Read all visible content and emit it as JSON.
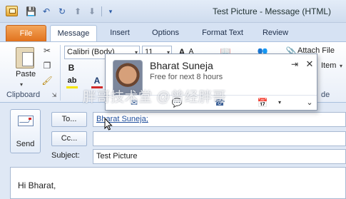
{
  "window": {
    "title": "Test Picture  -  Message (HTML)"
  },
  "quick_access": {
    "icons": [
      "save-icon",
      "undo-icon",
      "redo-icon",
      "up-arrow-icon",
      "down-arrow-icon",
      "customize-icon"
    ]
  },
  "ribbon_tabs": [
    "File",
    "Message",
    "Insert",
    "Options",
    "Format Text",
    "Review"
  ],
  "active_tab": "Message",
  "ribbon": {
    "clipboard": {
      "paste_label": "Paste",
      "group_label": "Clipboard"
    },
    "basic_text": {
      "font_name": "Calibri (Body)",
      "font_size": "11",
      "grow_font": "A",
      "shrink_font": "A",
      "bold": "B",
      "font_color": "A",
      "highlight": "ab"
    },
    "include": {
      "attach_file_label": "Attach File",
      "item_label": "Item",
      "group_tail": "de"
    }
  },
  "contact_card": {
    "name": "Bharat Suneja",
    "status": "Free for next 8 hours",
    "pin_icon": "pin-icon",
    "close_icon": "close-icon",
    "expand_icon": "chevron-down-icon"
  },
  "compose": {
    "send_label": "Send",
    "to_label": "To...",
    "cc_label": "Cc...",
    "subject_label": "Subject:",
    "to_value": "Bharat Suneja;",
    "cc_value": "",
    "subject_value": "Test Picture",
    "body_text": "Hi Bharat,"
  },
  "watermark": {
    "text": "胖哥技术堂 @曾经胖哥"
  },
  "colors": {
    "file_tab": "#e1721d",
    "accent_blue": "#2a5aa6",
    "recipient_link": "#1f4e9c",
    "highlight_yellow": "#f5e500",
    "font_color_red": "#d12a2a"
  }
}
